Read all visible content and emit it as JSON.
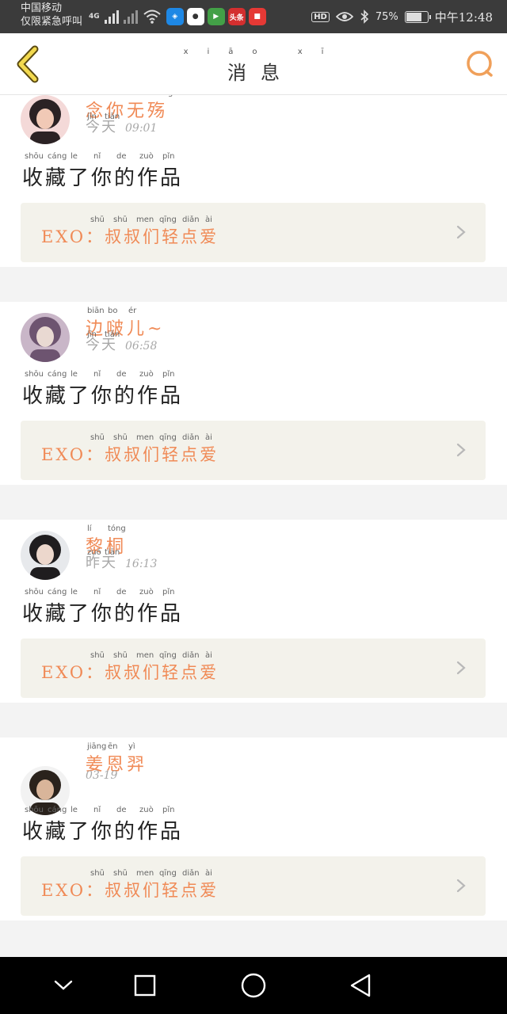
{
  "status_bar": {
    "carrier_line1": "中国移动",
    "carrier_line2": "仅限紧急呼叫",
    "network": "4G",
    "app_icons": [
      {
        "name": "shield-app-icon",
        "color": "#1e88e5",
        "glyph": "◈"
      },
      {
        "name": "robot-app-icon",
        "color": "#ffffff",
        "glyph": "●"
      },
      {
        "name": "play-app-icon",
        "color": "#43a047",
        "glyph": "▶"
      },
      {
        "name": "news-app-icon",
        "color": "#d32f2f",
        "glyph": "头条"
      },
      {
        "name": "bag-app-icon",
        "color": "#e53935",
        "glyph": "■"
      }
    ],
    "hd_label": "HD",
    "battery_label": "75%",
    "battery_level": 0.75,
    "time": "中午12:48"
  },
  "header": {
    "title": "消息",
    "title_pinyin": [
      "xiāo",
      "xī"
    ],
    "accent_color": "#f0a05a"
  },
  "messages": [
    {
      "user": "念你无殇",
      "user_pinyin": [
        "niàn",
        "nǐ",
        "wú",
        "shāng"
      ],
      "day": "今天",
      "day_pinyin": [
        "jīn",
        "tiān"
      ],
      "time": "09:01",
      "action": "收藏了你的作品",
      "action_pinyin": [
        "shōu",
        "cáng",
        "le",
        "nǐ",
        "de",
        "zuò",
        "pǐn"
      ],
      "work": "EXO：叔叔们轻点爱",
      "work_pinyin": [
        "shū",
        "shū",
        "men",
        "qīng",
        "diǎn",
        "ài"
      ]
    },
    {
      "user": "边啵儿~",
      "user_pinyin": [
        "biān",
        "bo",
        "ér"
      ],
      "day": "今天",
      "day_pinyin": [
        "jīn",
        "tiān"
      ],
      "time": "06:58",
      "action": "收藏了你的作品",
      "action_pinyin": [
        "shōu",
        "cáng",
        "le",
        "nǐ",
        "de",
        "zuò",
        "pǐn"
      ],
      "work": "EXO：叔叔们轻点爱",
      "work_pinyin": [
        "shū",
        "shū",
        "men",
        "qīng",
        "diǎn",
        "ài"
      ]
    },
    {
      "user": "黎桐",
      "user_pinyin": [
        "lí",
        "tóng"
      ],
      "day": "昨天",
      "day_pinyin": [
        "zuó",
        "tiān"
      ],
      "time": "16:13",
      "action": "收藏了你的作品",
      "action_pinyin": [
        "shōu",
        "cáng",
        "le",
        "nǐ",
        "de",
        "zuò",
        "pǐn"
      ],
      "work": "EXO：叔叔们轻点爱",
      "work_pinyin": [
        "shū",
        "shū",
        "men",
        "qīng",
        "diǎn",
        "ài"
      ]
    },
    {
      "user": "姜恩羿",
      "user_pinyin": [
        "jiāng",
        "ēn",
        "yì"
      ],
      "day": "",
      "day_pinyin": [],
      "time": "03-19",
      "action": "收藏了你的作品",
      "action_pinyin": [
        "shōu",
        "cáng",
        "le",
        "nǐ",
        "de",
        "zuò",
        "pǐn"
      ],
      "work": "EXO：叔叔们轻点爱",
      "work_pinyin": [
        "shū",
        "shū",
        "men",
        "qīng",
        "diǎn",
        "ài"
      ]
    }
  ],
  "nav_bar": {
    "buttons": [
      "chevron-down-icon",
      "recents-square-icon",
      "home-circle-icon",
      "back-triangle-icon"
    ]
  }
}
